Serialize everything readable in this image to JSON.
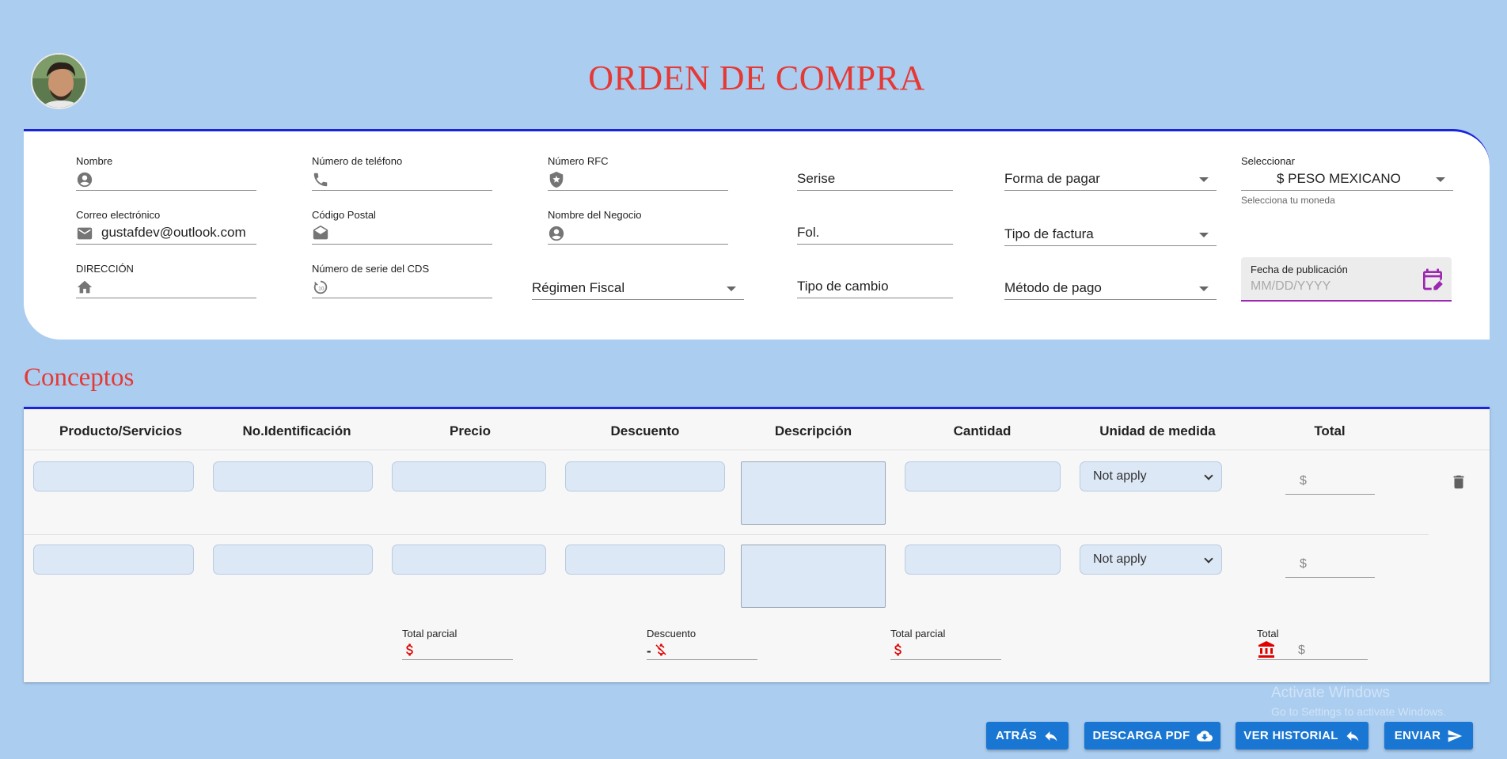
{
  "header": {
    "title": "ORDEN DE COMPRA"
  },
  "form": {
    "nombre": {
      "label": "Nombre",
      "value": ""
    },
    "telefono": {
      "label": "Número de teléfono",
      "value": ""
    },
    "rfc": {
      "label": "Número RFC",
      "value": ""
    },
    "serise": {
      "placeholder": "Serise"
    },
    "forma_pagar": {
      "placeholder": "Forma de pagar"
    },
    "moneda": {
      "label": "Seleccionar",
      "value": "$ PESO MEXICANO",
      "helper": "Selecciona tu moneda"
    },
    "correo": {
      "label": "Correo electrónico",
      "value": "gustafdev@outlook.com"
    },
    "codigo_postal": {
      "label": "Código Postal",
      "value": ""
    },
    "negocio": {
      "label": "Nombre del Negocio",
      "value": ""
    },
    "fol": {
      "placeholder": "Fol."
    },
    "tipo_factura": {
      "placeholder": "Tipo de factura"
    },
    "direccion": {
      "label": "DIRECCIÓN",
      "value": ""
    },
    "serie_cds": {
      "label": "Número de serie del CDS",
      "value": ""
    },
    "regimen": {
      "placeholder": "Régimen Fiscal"
    },
    "tipo_cambio": {
      "placeholder": "Tipo de cambio"
    },
    "metodo_pago": {
      "placeholder": "Método de pago"
    },
    "fecha": {
      "label": "Fecha de publicación",
      "placeholder": "MM/DD/YYYY"
    }
  },
  "conceptos": {
    "title": "Conceptos",
    "columns": [
      "Producto/Servicios",
      "No.Identificación",
      "Precio",
      "Descuento",
      "Descripción",
      "Cantidad",
      "Unidad de medida",
      "Total"
    ],
    "rows": [
      {
        "unidad": "Not apply",
        "total": "$"
      },
      {
        "unidad": "Not apply",
        "total": "$"
      }
    ],
    "summary": {
      "subtotal1_label": "Total parcial",
      "descuento_label": "Descuento",
      "descuento_prefix": "-",
      "subtotal2_label": "Total parcial",
      "total_label": "Total",
      "total_value": "$"
    }
  },
  "actions": {
    "atras": "ATRÁS",
    "pdf": "DESCARGA PDF",
    "historial": "VER HISTORIAL",
    "enviar": "ENVIAR"
  },
  "watermark": {
    "line1": "Activate Windows",
    "line2": "Go to Settings to activate Windows."
  },
  "colors": {
    "accent_red": "#e53935",
    "primary_blue": "#1976d2",
    "border_blue": "#1a24d8",
    "date_focus": "#9c27b0"
  }
}
